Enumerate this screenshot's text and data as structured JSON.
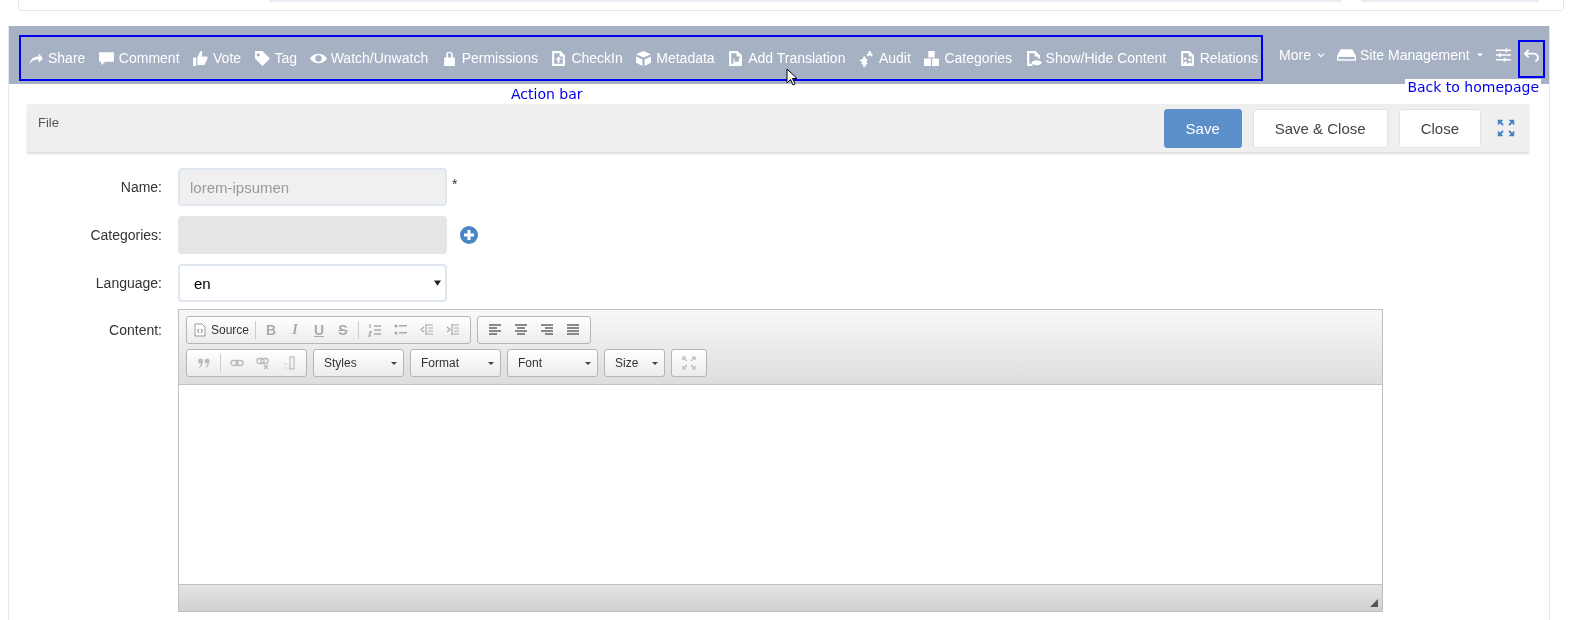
{
  "action_bar": {
    "actions": [
      {
        "label": "Share"
      },
      {
        "label": "Comment"
      },
      {
        "label": "Vote"
      },
      {
        "label": "Tag"
      },
      {
        "label": "Watch/Unwatch"
      },
      {
        "label": "Permissions"
      },
      {
        "label": "CheckIn"
      },
      {
        "label": "Metadata"
      },
      {
        "label": "Add Translation"
      },
      {
        "label": "Audit"
      },
      {
        "label": "Categories"
      },
      {
        "label": "Show/Hide Content"
      },
      {
        "label": "Relations"
      }
    ],
    "more": "More",
    "site_management": "Site Management"
  },
  "annotations": {
    "action_bar": "Action bar",
    "back": "Back to homepage"
  },
  "form_header": {
    "title": "File",
    "buttons": [
      {
        "label": "Save",
        "kind": "primary"
      },
      {
        "label": "Save & Close",
        "kind": "default"
      },
      {
        "label": "Close",
        "kind": "default"
      }
    ]
  },
  "fields": {
    "name": {
      "label": "Name:",
      "value": "lorem-ipsumen",
      "required_mark": "*"
    },
    "categories": {
      "label": "Categories:"
    },
    "language": {
      "label": "Language:",
      "value": "en"
    },
    "content": {
      "label": "Content:"
    }
  },
  "editor": {
    "source": "Source",
    "styles": [
      "B",
      "I",
      "U",
      "S"
    ],
    "combos": [
      "Styles",
      "Format",
      "Font",
      "Size"
    ]
  }
}
